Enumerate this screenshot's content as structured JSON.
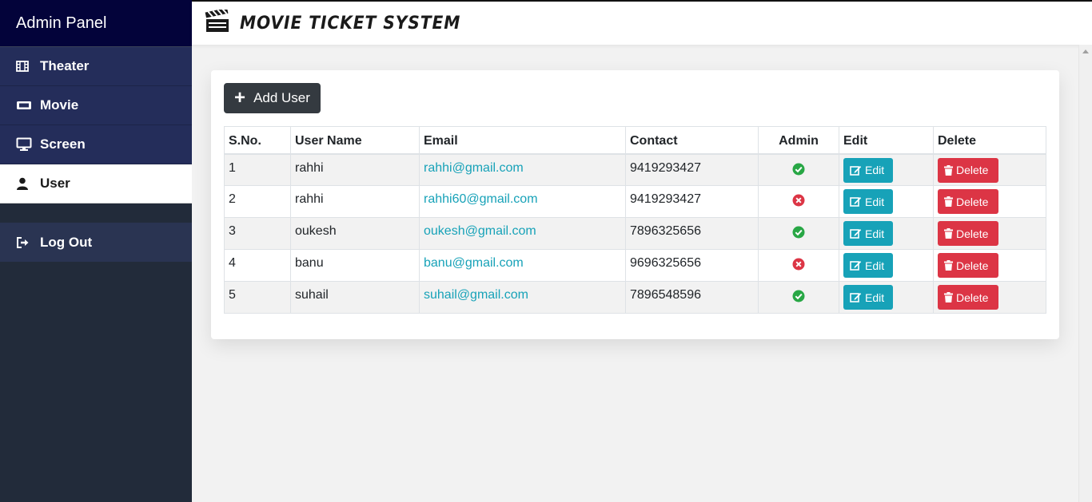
{
  "sidebar": {
    "title": "Admin Panel",
    "items": [
      {
        "label": "Theater",
        "icon": "film-icon"
      },
      {
        "label": "Movie",
        "icon": "ticket-icon"
      },
      {
        "label": "Screen",
        "icon": "monitor-icon"
      },
      {
        "label": "User",
        "icon": "user-icon"
      }
    ],
    "logout": {
      "label": "Log Out",
      "icon": "sign-out-icon"
    }
  },
  "header": {
    "title": "MOVIE TICKET SYSTEM",
    "icon": "clapperboard-icon"
  },
  "main": {
    "add_button_label": "Add User",
    "table": {
      "columns": [
        "S.No.",
        "User Name",
        "Email",
        "Contact",
        "Admin",
        "Edit",
        "Delete"
      ],
      "rows": [
        {
          "sno": "1",
          "name": "rahhi",
          "email": "rahhi@gmail.com",
          "contact": "9419293427",
          "admin": true
        },
        {
          "sno": "2",
          "name": "rahhi",
          "email": "rahhi60@gmail.com",
          "contact": "9419293427",
          "admin": false
        },
        {
          "sno": "3",
          "name": "oukesh",
          "email": "oukesh@gmail.com",
          "contact": "7896325656",
          "admin": true
        },
        {
          "sno": "4",
          "name": "banu",
          "email": "banu@gmail.com",
          "contact": "9696325656",
          "admin": false
        },
        {
          "sno": "5",
          "name": "suhail",
          "email": "suhail@gmail.com",
          "contact": "7896548596",
          "admin": true
        }
      ],
      "edit_label": "Edit",
      "delete_label": "Delete"
    }
  },
  "colors": {
    "sidebar_bg": "#222b3a",
    "sidebar_header_bg": "#03033a",
    "nav_bg": "#242d5a",
    "edit_button": "#17a2b8",
    "delete_button": "#dc3545",
    "admin_yes": "#28a745",
    "admin_no": "#dc3545"
  }
}
